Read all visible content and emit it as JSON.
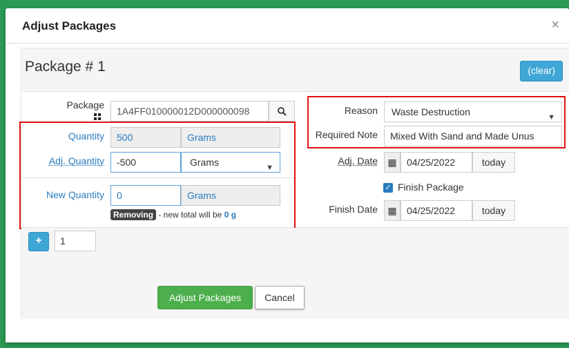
{
  "modal": {
    "title": "Adjust Packages",
    "close_glyph": "×"
  },
  "package": {
    "title": "Package # 1",
    "clear_label": "(clear)",
    "package_label": "Package",
    "package_value": "1A4FF010000012D000000098",
    "quantity_label": "Quantity",
    "quantity_value": "500",
    "quantity_unit": "Grams",
    "adj_quantity_label": "Adj. Quantity",
    "adj_quantity_value": "-500",
    "adj_quantity_unit": "Grams",
    "new_quantity_label": "New Quantity",
    "new_quantity_value": "0",
    "new_quantity_unit": "Grams",
    "removing_badge": "Removing",
    "new_total_text": " - new total will be ",
    "new_total_value": "0 g",
    "reason_label": "Reason",
    "reason_value": "Waste Destruction",
    "required_note_label": "Required Note",
    "required_note_value": "Mixed With Sand and Made Unus",
    "adj_date_label": "Adj. Date",
    "adj_date_value": "04/25/2022",
    "today_label": "today",
    "finish_package_label": "Finish Package",
    "finish_date_label": "Finish Date",
    "finish_date_value": "04/25/2022"
  },
  "footer": {
    "add_glyph": "+",
    "count_value": "1",
    "adjust_label": "Adjust Packages",
    "cancel_label": "Cancel"
  },
  "colors": {
    "accent_blue": "#3fa7d6",
    "success_green": "#4cae4c",
    "highlight_red": "#e01010",
    "background_green": "#2a9a55"
  }
}
